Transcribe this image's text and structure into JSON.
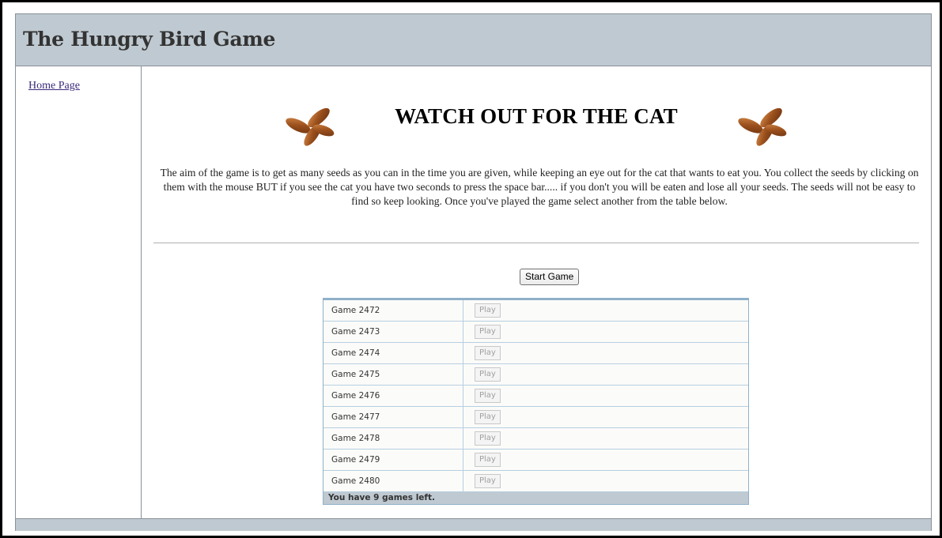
{
  "header": {
    "title": "The Hungry Bird Game"
  },
  "sidebar": {
    "home_link": "Home Page"
  },
  "main": {
    "banner_title": "WATCH OUT FOR THE CAT",
    "description": "The aim of the game is to get as many seeds as you can in the time you are given, while keeping an eye out for the cat that wants to eat you. You collect the seeds by clicking on them with the mouse BUT if you see the cat you have two seconds to press the space bar..... if you don't you will be eaten and lose all your seeds. The seeds will not be easy to find so keep looking. Once you've played the game select another from the table below.",
    "start_button": "Start Game",
    "banner_icons": [
      "seeds-icon",
      "seeds-icon"
    ]
  },
  "games": {
    "play_label": "Play",
    "rows": [
      {
        "name": "Game 2472"
      },
      {
        "name": "Game 2473"
      },
      {
        "name": "Game 2474"
      },
      {
        "name": "Game 2475"
      },
      {
        "name": "Game 2476"
      },
      {
        "name": "Game 2477"
      },
      {
        "name": "Game 2478"
      },
      {
        "name": "Game 2479"
      },
      {
        "name": "Game 2480"
      }
    ],
    "footer": "You have 9 games left."
  },
  "colors": {
    "header_bg": "#bfc9d1",
    "table_border": "#8fb0c9",
    "seed": "#9a4f1c"
  }
}
